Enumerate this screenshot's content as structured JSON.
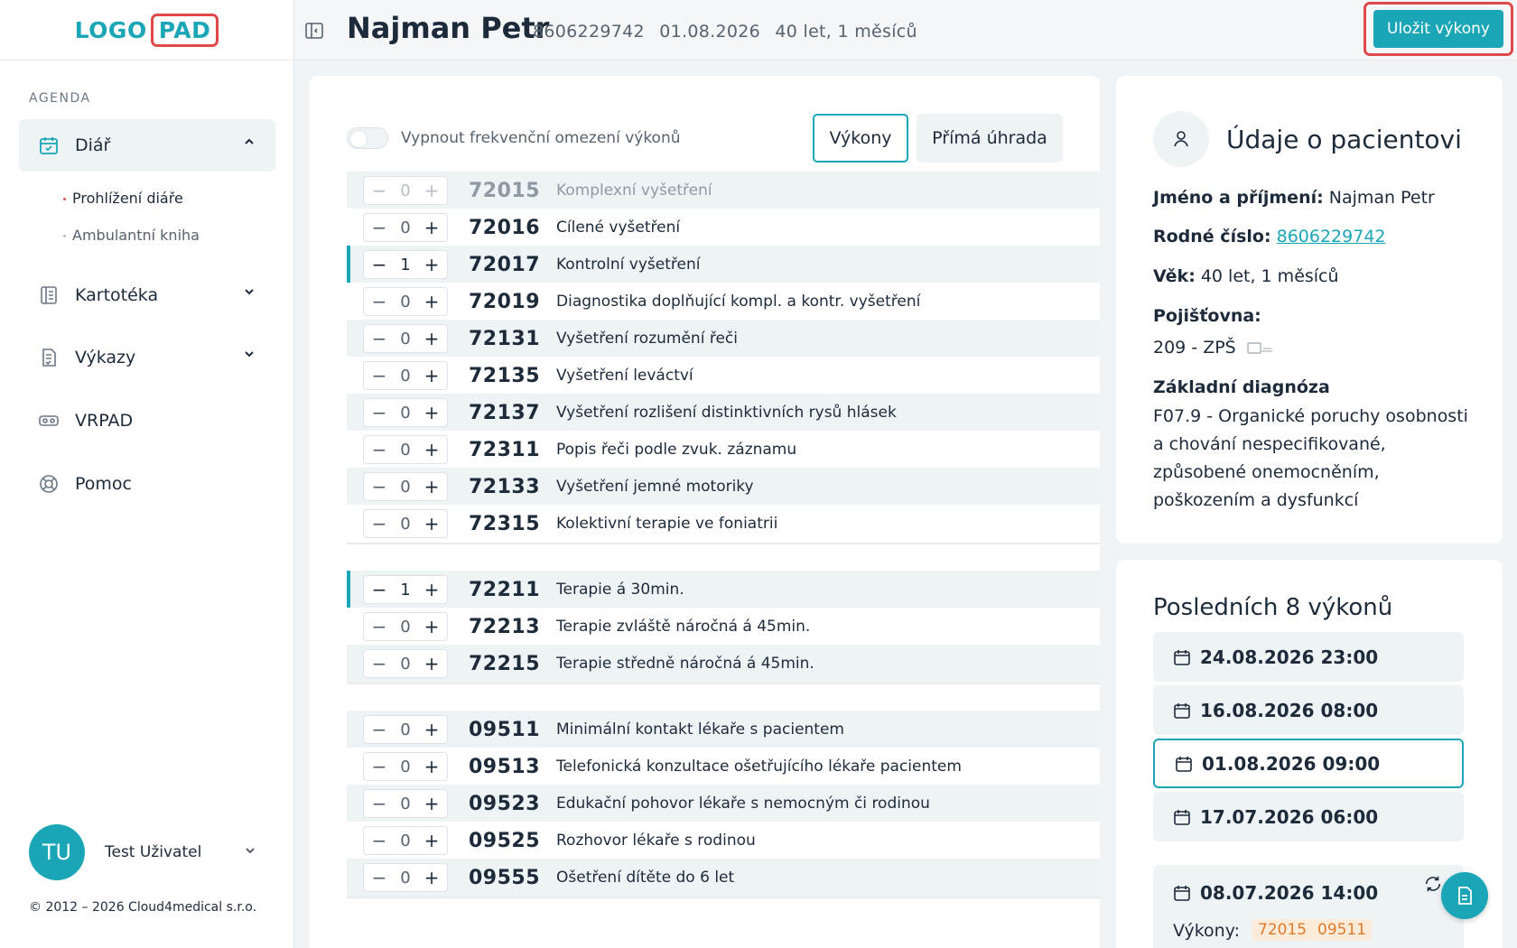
{
  "logo": {
    "part1": "LOGO",
    "part2": "PAD"
  },
  "sidebar": {
    "section_label": "AGENDA",
    "items": [
      {
        "label": "Diář",
        "icon": "calendar-check-icon"
      },
      {
        "label": "Kartotéka",
        "icon": "card-index-icon"
      },
      {
        "label": "Výkazy",
        "icon": "report-icon"
      },
      {
        "label": "VRPAD",
        "icon": "vr-headset-icon"
      },
      {
        "label": "Pomoc",
        "icon": "lifebuoy-icon"
      }
    ],
    "subitems": [
      {
        "label": "Prohlížení diáře"
      },
      {
        "label": "Ambulantní kniha"
      }
    ],
    "user": {
      "initials": "TU",
      "name": "Test Uživatel"
    },
    "copyright": "© 2012 – 2026 Cloud4medical s.r.o."
  },
  "header": {
    "patient_name": "Najman Petr",
    "birth_number": "8606229742",
    "date": "01.08.2026",
    "age": "40 let, 1 měsíců",
    "save_label": "Uložit výkony"
  },
  "main": {
    "toggle_label": "Vypnout frekvenční omezení výkonů",
    "tabs": [
      {
        "label": "Výkony"
      },
      {
        "label": "Přímá úhrada"
      }
    ],
    "rows": [
      {
        "count": "0",
        "code": "72015",
        "desc": "Komplexní vyšetření"
      },
      {
        "count": "0",
        "code": "72016",
        "desc": "Cílené vyšetření"
      },
      {
        "count": "1",
        "code": "72017",
        "desc": "Kontrolní vyšetření"
      },
      {
        "count": "0",
        "code": "72019",
        "desc": "Diagnostika doplňující kompl. a kontr. vyšetření"
      },
      {
        "count": "0",
        "code": "72131",
        "desc": "Vyšetření rozumění řeči"
      },
      {
        "count": "0",
        "code": "72135",
        "desc": "Vyšetření leváctví"
      },
      {
        "count": "0",
        "code": "72137",
        "desc": "Vyšetření rozlišení distinktivních rysů hlásek"
      },
      {
        "count": "0",
        "code": "72311",
        "desc": "Popis řeči podle zvuk. záznamu"
      },
      {
        "count": "0",
        "code": "72133",
        "desc": "Vyšetření jemné motoriky"
      },
      {
        "count": "0",
        "code": "72315",
        "desc": "Kolektivní terapie ve foniatrii"
      },
      {
        "count": "1",
        "code": "72211",
        "desc": "Terapie á 30min."
      },
      {
        "count": "0",
        "code": "72213",
        "desc": "Terapie zvláště náročná á 45min."
      },
      {
        "count": "0",
        "code": "72215",
        "desc": "Terapie středně náročná á 45min."
      },
      {
        "count": "0",
        "code": "09511",
        "desc": "Minimální kontakt lékaře s pacientem"
      },
      {
        "count": "0",
        "code": "09513",
        "desc": "Telefonická konzultace ošetřujícího lékaře pacientem"
      },
      {
        "count": "0",
        "code": "09523",
        "desc": "Edukační pohovor lékaře s nemocným či rodinou"
      },
      {
        "count": "0",
        "code": "09525",
        "desc": "Rozhovor lékaře s rodinou"
      },
      {
        "count": "0",
        "code": "09555",
        "desc": "Ošetření dítěte do 6 let"
      }
    ]
  },
  "patient_info": {
    "title": "Údaje o pacientovi",
    "name_label": "Jméno a příjmení:",
    "name_value": "Najman Petr",
    "birth_label": "Rodné číslo:",
    "birth_value": "8606229742",
    "age_label": "Věk:",
    "age_value": "40 let, 1 měsíců",
    "insurance_label": "Pojišťovna:",
    "insurance_value": "209 - ZPŠ",
    "diagnosis_label": "Základní diagnóza",
    "diagnosis_value": "F07.9 - Organické poruchy osobnosti a chování nespecifikované, způsobené onemocněním, poškozením a dysfunkcí"
  },
  "history": {
    "title": "Posledních 8 výkonů",
    "items": [
      {
        "date": "24.08.2026 23:00"
      },
      {
        "date": "16.08.2026 08:00"
      },
      {
        "date": "01.08.2026 09:00"
      },
      {
        "date": "17.07.2026 06:00"
      },
      {
        "date": "08.07.2026 14:00"
      }
    ],
    "vykony_label": "Výkony:",
    "chips": [
      "72015",
      "09511"
    ]
  },
  "colors": {
    "accent": "#1aa6b7",
    "highlight": "#e0484a",
    "chip_bg": "#fdebd9",
    "chip_text": "#e07b2c"
  }
}
